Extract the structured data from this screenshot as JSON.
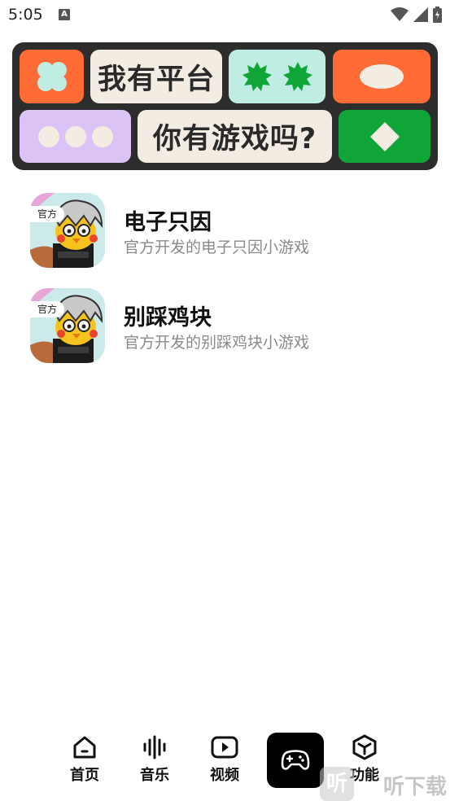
{
  "status_bar": {
    "time": "5:05",
    "notif_letter": "A"
  },
  "banner": {
    "text1": "我有平台",
    "text2": "你有游戏吗?",
    "colors": {
      "background": "#2d2d2d",
      "orange": "#ff6b35",
      "cream": "#f3ece3",
      "mint": "#bfece3",
      "green": "#10a637",
      "lavender": "#dcc3f5"
    }
  },
  "games": [
    {
      "badge": "官方",
      "title": "电子只因",
      "desc": "官方开发的电子只因小游戏"
    },
    {
      "badge": "官方",
      "title": "别踩鸡块",
      "desc": "官方开发的别踩鸡块小游戏"
    }
  ],
  "nav": [
    {
      "label": "首页",
      "icon": "home-icon"
    },
    {
      "label": "音乐",
      "icon": "audio-wave-icon"
    },
    {
      "label": "视频",
      "icon": "play-icon"
    },
    {
      "label": "",
      "icon": "gamepad-icon"
    },
    {
      "label": "功能",
      "icon": "cube-icon"
    }
  ],
  "watermark": {
    "box": "听",
    "text": "听下载"
  }
}
